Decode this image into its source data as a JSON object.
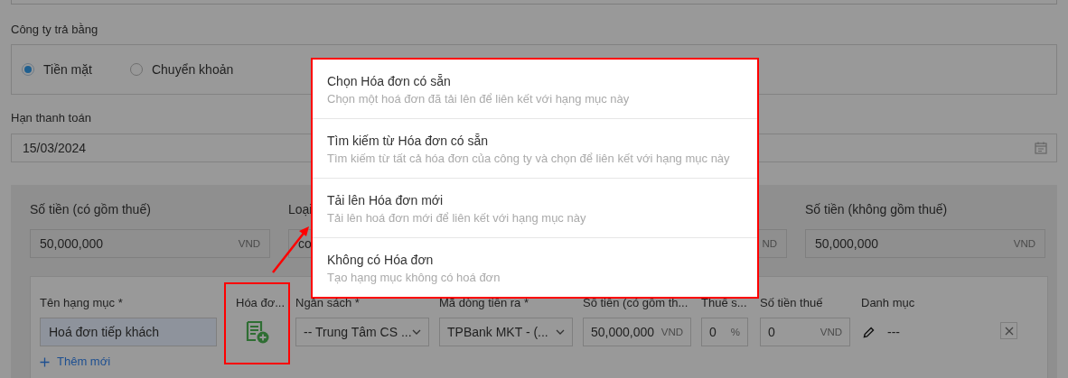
{
  "payment_method": {
    "label": "Công ty trả bằng",
    "options": [
      {
        "label": "Tiền mặt",
        "selected": true
      },
      {
        "label": "Chuyển khoản",
        "selected": false
      }
    ]
  },
  "due_date": {
    "label": "Hạn thanh toán",
    "value": "15/03/2024"
  },
  "amount_fields": [
    {
      "label": "Số tiền (có gồm thuế)",
      "value": "50,000,000",
      "unit": "VND"
    },
    {
      "label": "Loại",
      "value": "co"
    },
    {
      "unit": "ND"
    },
    {
      "label": "Số tiền (không gồm thuế)",
      "value": "50,000,000",
      "unit": "VND"
    }
  ],
  "line_item": {
    "columns": [
      {
        "kind": "text",
        "label": "Tên hạng mục *",
        "value": "Hoá đơn tiếp khách"
      },
      {
        "kind": "invoice",
        "label": "Hóa đơ..."
      },
      {
        "kind": "select",
        "label": "Ngân sách *",
        "value": "-- Trung Tâm CS ..."
      },
      {
        "kind": "select",
        "label": "Mã dòng tiền ra *",
        "value": "TPBank MKT - (..."
      },
      {
        "kind": "amount",
        "label": "Số tiền (có gồm th...",
        "value": "50,000,000",
        "unit": "VND"
      },
      {
        "kind": "amount",
        "label": "Thuế s...",
        "value": "0",
        "unit": "%"
      },
      {
        "kind": "amount",
        "label": "Số tiền thuế",
        "value": "0",
        "unit": "VND"
      },
      {
        "kind": "category",
        "label": "Danh mục",
        "value": "---"
      }
    ],
    "add_label": "Thêm mới"
  },
  "invoice_menu": {
    "items": [
      {
        "title": "Chọn Hóa đơn có sẵn",
        "description": "Chọn một hoá đơn đã tải lên để liên kết với hạng mục này"
      },
      {
        "title": "Tìm kiếm từ Hóa đơn có sẵn",
        "description": "Tìm kiếm từ tất cả hóa đơn của công ty và chọn để liên kết với hạng mục này"
      },
      {
        "title": "Tải lên Hóa đơn mới",
        "description": "Tải lên hoá đơn mới để liên kết với hạng mục này"
      },
      {
        "title": "Không có Hóa đơn",
        "description": "Tạo hạng mục không có hoá đơn"
      }
    ]
  }
}
